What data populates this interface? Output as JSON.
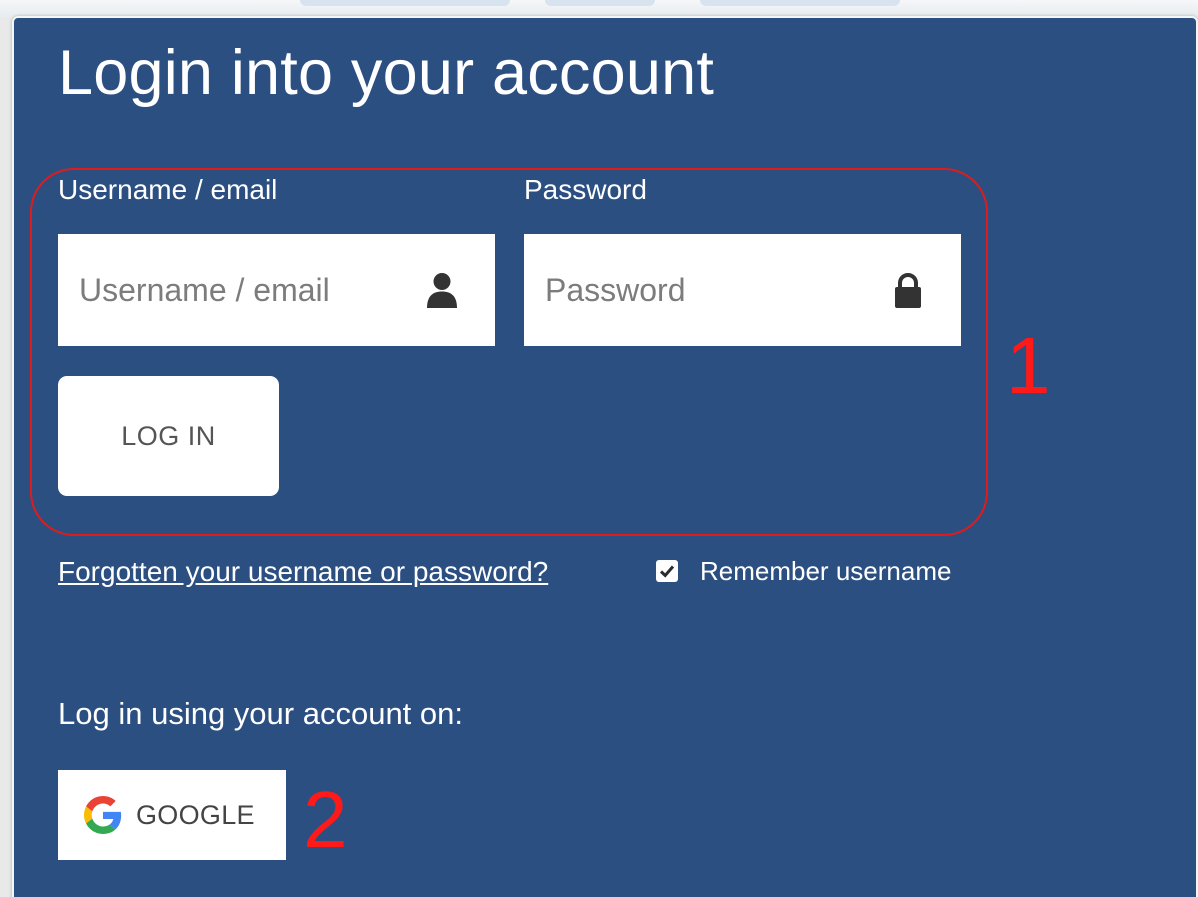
{
  "login": {
    "title": "Login into your account",
    "username": {
      "label": "Username / email",
      "placeholder": "Username / email",
      "value": "",
      "icon": "user-icon"
    },
    "password": {
      "label": "Password",
      "placeholder": "Password",
      "value": "",
      "icon": "lock-icon"
    },
    "login_button": "LOG IN",
    "forgot_link": "Forgotten your username or password?",
    "remember": {
      "label": "Remember username",
      "checked": true
    }
  },
  "external": {
    "label": "Log in using your account on:",
    "providers": [
      {
        "label": "GOOGLE",
        "icon": "google-g-icon"
      }
    ]
  },
  "annotations": {
    "marker_1": "1",
    "marker_2": "2",
    "color": "#ff1a1a"
  },
  "colors": {
    "panel_background": "#2c4f82",
    "text": "#ffffff"
  }
}
